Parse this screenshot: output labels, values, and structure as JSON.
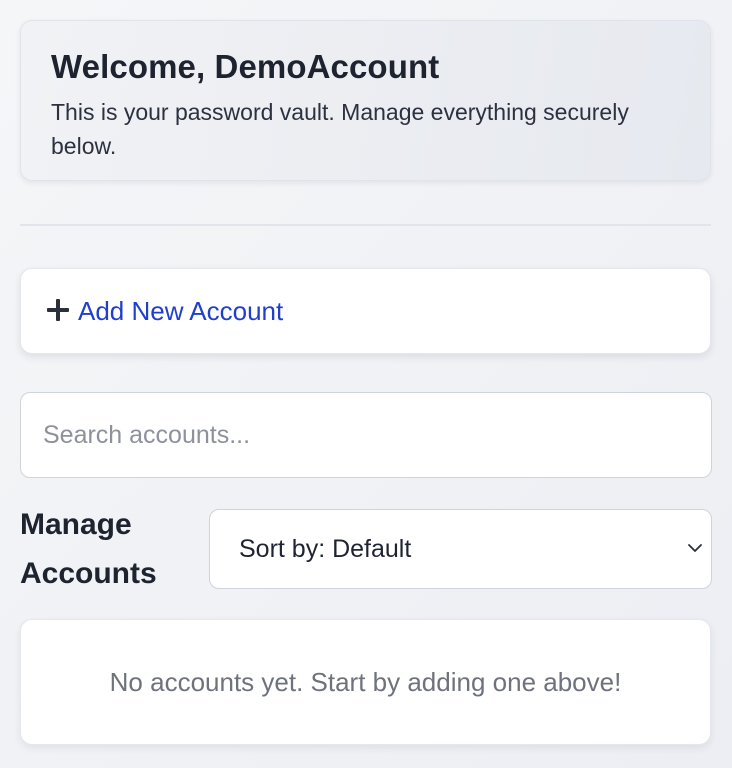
{
  "welcome": {
    "title": "Welcome, DemoAccount",
    "subtitle": "This is your password vault. Manage everything securely below."
  },
  "add_account": {
    "icon": "plus-icon",
    "label": "Add New Account",
    "label_color": "#1f3fcf"
  },
  "search": {
    "value": "",
    "placeholder": "Search accounts..."
  },
  "manage": {
    "title": "Manage Accounts",
    "sort": {
      "selected": "Sort by: Default",
      "icon": "chevron-down-icon"
    }
  },
  "accounts": {
    "items": [],
    "empty_message": "No accounts yet. Start by adding one above!"
  }
}
